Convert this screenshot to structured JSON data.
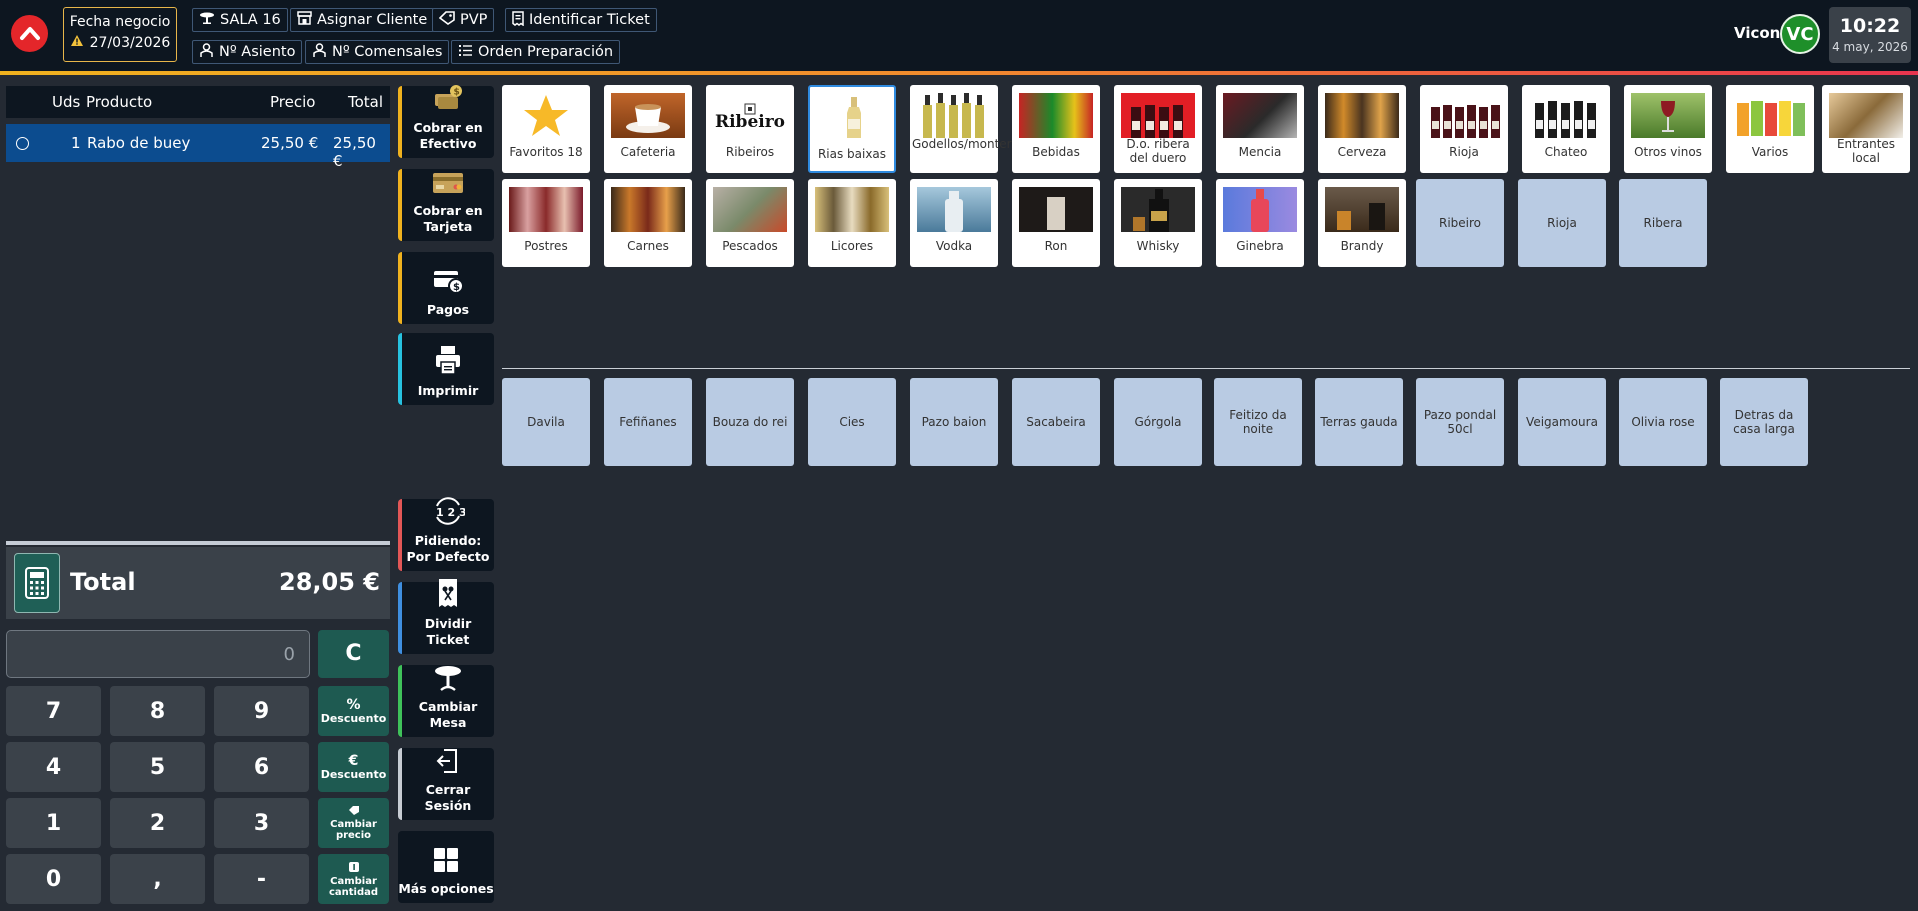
{
  "header": {
    "fecha_label": "Fecha negocio",
    "fecha_value": "27/03/2026",
    "chips": {
      "sala": "SALA 16",
      "asignar_cliente": "Asignar Cliente",
      "pvp": "PVP",
      "identificar_ticket": "Identificar Ticket",
      "asiento": "Nº Asiento",
      "comensales": "Nº Comensales",
      "orden_preparacion": "Orden Preparación"
    },
    "user": "Vicon",
    "avatar_initials": "VC",
    "time": "10:22",
    "date": "4 may, 2026"
  },
  "ticket": {
    "columns": {
      "uds": "Uds",
      "producto": "Producto",
      "precio": "Precio",
      "total": "Total"
    },
    "rows": [
      {
        "uds": "1",
        "producto": "Rabo de buey",
        "precio": "25,50 €",
        "total": "25,50 €"
      }
    ],
    "total_label": "Total",
    "total_value": "28,05 €"
  },
  "keypad": {
    "input_value": "0",
    "clear": "C",
    "keys": [
      "7",
      "8",
      "9",
      "4",
      "5",
      "6",
      "1",
      "2",
      "3",
      "0",
      ",",
      "-"
    ],
    "functions": {
      "pct_symbol": "%",
      "pct_label": "Descuento",
      "eur_symbol": "€",
      "eur_label": "Descuento",
      "price_label_1": "Cambiar",
      "price_label_2": "precio",
      "qty_label_1": "Cambiar",
      "qty_label_2": "cantidad"
    }
  },
  "actions": {
    "cobrar_efectivo": [
      "Cobrar en",
      "Efectivo"
    ],
    "cobrar_tarjeta": [
      "Cobrar en",
      "Tarjeta"
    ],
    "pagos": "Pagos",
    "imprimir": "Imprimir",
    "pidiendo": [
      "Pidiendo:",
      "Por Defecto"
    ],
    "dividir": [
      "Dividir",
      "Ticket"
    ],
    "cambiar_mesa": [
      "Cambiar",
      "Mesa"
    ],
    "cerrar_sesion": [
      "Cerrar",
      "Sesión"
    ],
    "mas_opciones": "Más opciones"
  },
  "categories": {
    "row1": [
      "Favoritos 18",
      "Cafeteria",
      "Ribeiros",
      "Rias baixas",
      "Godellos/monterrey",
      "Bebidas",
      "D.o. ribera del duero",
      "Mencia",
      "Cerveza",
      "Rioja",
      "Chateo",
      "Otros vinos",
      "Varios",
      "Entrantes local"
    ],
    "row2": [
      "Postres",
      "Carnes",
      "Pescados",
      "Licores",
      "Vodka",
      "Ron",
      "Whisky",
      "Ginebra",
      "Brandy"
    ],
    "row2_sub": [
      "Ribeiro",
      "Rioja",
      "Ribera"
    ],
    "ribeiro_logo_text": "Ribeiro"
  },
  "products": [
    "Davila",
    "Fefiñanes",
    "Bouza do rei",
    "Cies",
    "Pazo baion",
    "Sacabeira",
    "Górgola",
    "Feitizo da noite",
    "Terras gauda",
    "Pazo pondal 50cl",
    "Veigamoura",
    "Olivia rose",
    "Detras da casa larga"
  ],
  "colors": {
    "accent_orange": "#f0b21f",
    "accent_red": "#e8344e",
    "selected_row": "#0c4c8f",
    "subcategory_tile": "#b9cbe3",
    "function_key": "#1e5a51"
  }
}
